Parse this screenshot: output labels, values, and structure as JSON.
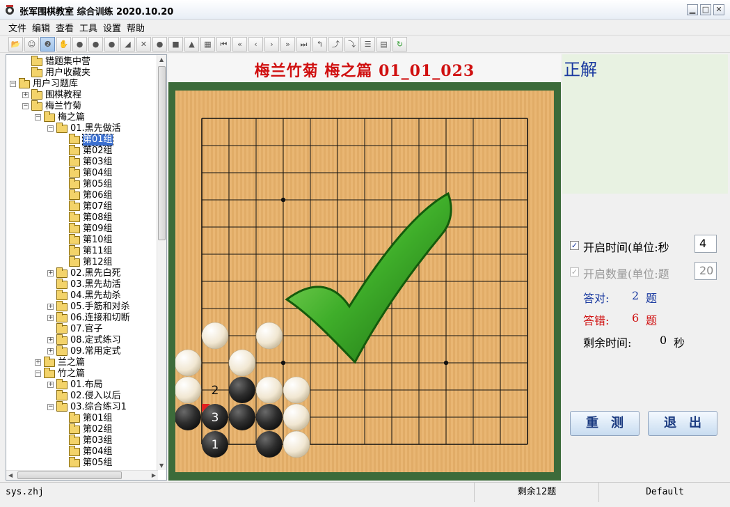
{
  "window": {
    "title": "张军围棋教室 综合训练 2020.10.20",
    "minimize": "▁",
    "maximize": "□",
    "close": "✕"
  },
  "menu": [
    "文件",
    "编辑",
    "查看",
    "工具",
    "设置",
    "帮助"
  ],
  "toolbar_icons": [
    "open-folder-icon",
    "user-icon",
    "numbered-stone-icon",
    "hand-icon",
    "stones-icon",
    "black-stone-icon",
    "gray-stone-icon",
    "triangle-tool-icon",
    "cross-mark-icon",
    "circle-mark-icon",
    "square-mark-icon",
    "triangle-mark-icon",
    "area-mark-icon",
    "first-move-icon",
    "back-fast-icon",
    "back-icon",
    "forward-icon",
    "forward-fast-icon",
    "last-move-icon",
    "undo-branch-icon",
    "branch-icon",
    "pass-icon",
    "list-icon",
    "comment-icon",
    "refresh-icon"
  ],
  "tree": [
    {
      "label": "错题集中营",
      "level": 1,
      "expander": ""
    },
    {
      "label": "用户收藏夹",
      "level": 1,
      "expander": ""
    },
    {
      "label": "用户习题库",
      "level": 0,
      "expander": "−"
    },
    {
      "label": "围棋教程",
      "level": 1,
      "expander": "+"
    },
    {
      "label": "梅兰竹菊",
      "level": 1,
      "expander": "−"
    },
    {
      "label": "梅之篇",
      "level": 2,
      "expander": "−"
    },
    {
      "label": "01.黑先做活",
      "level": 3,
      "expander": "−"
    },
    {
      "label": "第01组",
      "level": 4,
      "expander": "",
      "selected": true
    },
    {
      "label": "第02组",
      "level": 4,
      "expander": ""
    },
    {
      "label": "第03组",
      "level": 4,
      "expander": ""
    },
    {
      "label": "第04组",
      "level": 4,
      "expander": ""
    },
    {
      "label": "第05组",
      "level": 4,
      "expander": ""
    },
    {
      "label": "第06组",
      "level": 4,
      "expander": ""
    },
    {
      "label": "第07组",
      "level": 4,
      "expander": ""
    },
    {
      "label": "第08组",
      "level": 4,
      "expander": ""
    },
    {
      "label": "第09组",
      "level": 4,
      "expander": ""
    },
    {
      "label": "第10组",
      "level": 4,
      "expander": ""
    },
    {
      "label": "第11组",
      "level": 4,
      "expander": ""
    },
    {
      "label": "第12组",
      "level": 4,
      "expander": ""
    },
    {
      "label": "02.黑先白死",
      "level": 3,
      "expander": "+"
    },
    {
      "label": "03.黑先劫活",
      "level": 3,
      "expander": ""
    },
    {
      "label": "04.黑先劫杀",
      "level": 3,
      "expander": ""
    },
    {
      "label": "05.手筋和对杀",
      "level": 3,
      "expander": "+"
    },
    {
      "label": "06.连接和切断",
      "level": 3,
      "expander": "+"
    },
    {
      "label": "07.官子",
      "level": 3,
      "expander": ""
    },
    {
      "label": "08.定式练习",
      "level": 3,
      "expander": "+"
    },
    {
      "label": "09.常用定式",
      "level": 3,
      "expander": "+"
    },
    {
      "label": "兰之篇",
      "level": 2,
      "expander": "+"
    },
    {
      "label": "竹之篇",
      "level": 2,
      "expander": "−"
    },
    {
      "label": "01.布局",
      "level": 3,
      "expander": "+"
    },
    {
      "label": "02.侵入以后",
      "level": 3,
      "expander": ""
    },
    {
      "label": "03.综合练习1",
      "level": 3,
      "expander": "−"
    },
    {
      "label": "第01组",
      "level": 4,
      "expander": ""
    },
    {
      "label": "第02组",
      "level": 4,
      "expander": ""
    },
    {
      "label": "第03组",
      "level": 4,
      "expander": ""
    },
    {
      "label": "第04组",
      "level": 4,
      "expander": ""
    },
    {
      "label": "第05组",
      "level": 4,
      "expander": ""
    }
  ],
  "problem": {
    "title": "梅兰竹菊 梅之篇 01_01_023"
  },
  "board": {
    "size": 13,
    "star_points": [
      [
        3,
        3
      ],
      [
        3,
        9
      ],
      [
        9,
        3
      ],
      [
        9,
        9
      ]
    ],
    "white_stones": [
      [
        1,
        8
      ],
      [
        3,
        8
      ],
      [
        0,
        9
      ],
      [
        2,
        9
      ],
      [
        0,
        10
      ],
      [
        3,
        10
      ],
      [
        4,
        10
      ],
      [
        4,
        11
      ],
      [
        4,
        12
      ]
    ],
    "black_stones": [
      [
        2,
        10
      ],
      [
        0,
        11
      ],
      [
        1,
        11
      ],
      [
        2,
        11
      ],
      [
        3,
        11
      ],
      [
        1,
        12
      ],
      [
        3,
        12
      ]
    ],
    "move_labels": [
      {
        "col": 1,
        "row": 10,
        "text": "2",
        "color": "white"
      },
      {
        "col": 1,
        "row": 11,
        "text": "3",
        "color": "black"
      },
      {
        "col": 1,
        "row": 12,
        "text": "1",
        "color": "black"
      }
    ],
    "last_move_marker_color": "#e02020",
    "result_icon": "green-check-icon"
  },
  "right": {
    "answer_label": "正解",
    "time_option": {
      "label": "开启时间(单位:秒",
      "checked": true,
      "value": "4"
    },
    "count_option": {
      "label": "开启数量(单位:题",
      "checked": true,
      "disabled": true,
      "value": "20"
    },
    "correct_label": "答对:",
    "correct_value": "2",
    "correct_unit": "题",
    "wrong_label": "答错:",
    "wrong_value": "6",
    "wrong_unit": "题",
    "remain_label": "剩余时间:",
    "remain_value": "0",
    "remain_unit": "秒",
    "retest_button": "重测",
    "exit_button": "退出"
  },
  "colors": {
    "correct": "#1a3aa0",
    "wrong": "#d01010",
    "board": "#e8b26a",
    "board_frame": "#3c6b3a",
    "check": "#3fae2a"
  },
  "status": {
    "user": "sys.zhj",
    "remaining": "剩余12题",
    "theme": "Default"
  }
}
